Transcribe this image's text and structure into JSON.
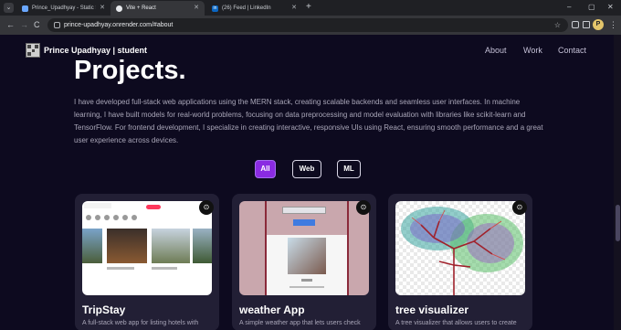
{
  "browser": {
    "tabs": [
      {
        "title": "Prince_Upadhyay - Static Site -",
        "favicon_color": "#6aa7ff",
        "active": false
      },
      {
        "title": "Vite + React",
        "favicon_color": "#e8eaed",
        "active": true
      },
      {
        "title": "(26) Feed | LinkedIn",
        "favicon_color": "#0a66c2",
        "favicon_text": "in",
        "active": false
      }
    ],
    "new_tab": "+",
    "url": "prince-upadhyay.onrender.com/#about",
    "profile_initial": "P",
    "window_controls": {
      "minimize": "–",
      "maximize": "▢",
      "close": "✕"
    },
    "nav": {
      "back": "←",
      "forward": "→",
      "reload": "C"
    }
  },
  "site": {
    "brand": "Prince Upadhyay | student",
    "nav": [
      "About",
      "Work",
      "Contact"
    ]
  },
  "projects": {
    "title": "Projects.",
    "description": "I have developed full-stack web applications using the MERN stack, creating scalable backends and seamless user interfaces. In machine learning, I have built models for real-world problems, focusing on data preprocessing and model evaluation with libraries like scikit-learn and TensorFlow. For frontend development, I specialize in creating interactive, responsive UIs using React, ensuring smooth performance and a great user experience across devices.",
    "filters": [
      "All",
      "Web",
      "ML"
    ],
    "active_filter": "All",
    "cards": [
      {
        "title": "TripStay",
        "desc": "A full-stack web app for listing hotels with"
      },
      {
        "title": "weather App",
        "desc": "A simple weather app that lets users check"
      },
      {
        "title": "tree visualizer",
        "desc": "A tree visualizer that allows users to create"
      }
    ]
  },
  "colors": {
    "accent": "#8a2be2",
    "background": "#0d0a1f",
    "card": "#221f35"
  }
}
